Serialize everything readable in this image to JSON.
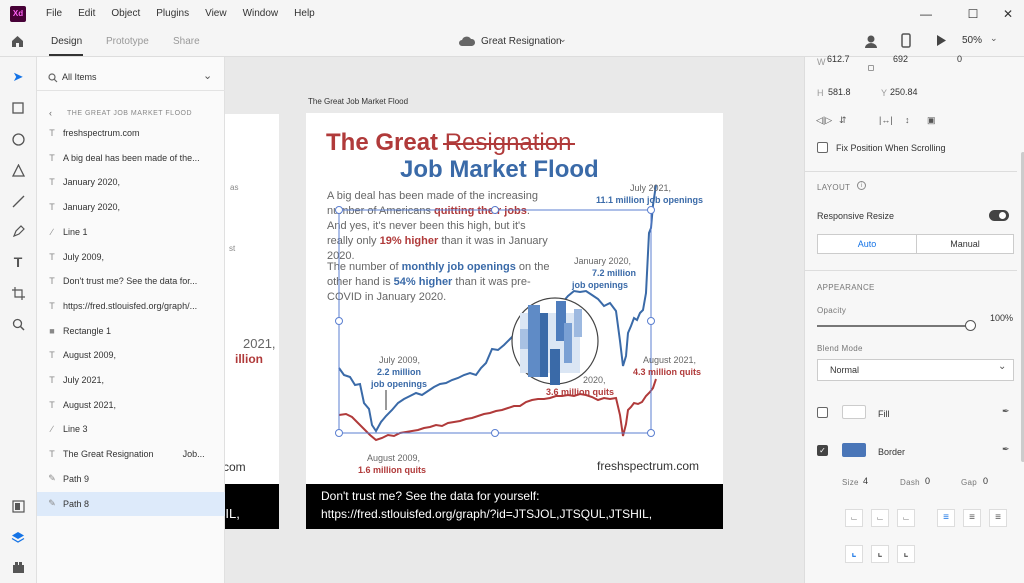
{
  "menu": [
    "File",
    "Edit",
    "Object",
    "Plugins",
    "View",
    "Window",
    "Help"
  ],
  "app_badge": "Xd",
  "toolbar": {
    "tabs": [
      "Design",
      "Prototype",
      "Share"
    ],
    "doc_title": "Great Resignation",
    "zoom": "50%"
  },
  "layers": {
    "filter": "All Items",
    "group": "THE GREAT JOB MARKET FLOOD",
    "items": [
      {
        "label": "freshspectrum.com",
        "icon": "text"
      },
      {
        "label": "A big deal has been made of the...",
        "icon": "text"
      },
      {
        "label": "January 2020,",
        "icon": "text"
      },
      {
        "label": "January 2020,",
        "icon": "text"
      },
      {
        "label": "Line 1",
        "icon": "line"
      },
      {
        "label": "July 2009,",
        "icon": "text"
      },
      {
        "label": "Don't trust me? See the data for...",
        "icon": "text"
      },
      {
        "label": "https://fred.stlouisfed.org/graph/...",
        "icon": "text"
      },
      {
        "label": "Rectangle 1",
        "icon": "rect"
      },
      {
        "label": "August 2009,",
        "icon": "text"
      },
      {
        "label": "July 2021,",
        "icon": "text"
      },
      {
        "label": "August 2021,",
        "icon": "text"
      },
      {
        "label": "Line 3",
        "icon": "line"
      },
      {
        "label": "The Great Resignation",
        "label2": "Job...",
        "icon": "text"
      },
      {
        "label": "Path 9",
        "icon": "path"
      },
      {
        "label": "Path 8",
        "icon": "path"
      }
    ]
  },
  "artboard": {
    "label": "The Great Job Market Flood",
    "title1": "The Great ",
    "title_strike": "Resignation",
    "title2": "Job Market Flood",
    "para1_a": "A big deal has been made of the increasing number of Americans ",
    "para1_b": "quitting their jobs",
    "para1_c": ". And yes, it's never been this high, but it's really only ",
    "para1_d": "19% higher",
    "para1_e": " than it was in January 2020.",
    "para2_a": "The number of ",
    "para2_b": "monthly job openings",
    "para2_c": " on the other hand is ",
    "para2_d": "54% higher",
    "para2_e": " than it was pre-COVID in January 2020.",
    "ann_jul2021_1": "July 2021,",
    "ann_jul2021_2": "11.1 million job openings",
    "ann_jan2020_1": "January 2020,",
    "ann_jan2020_2": "7.2 million",
    "ann_jan2020_3": "job openings",
    "ann_jul2009_1": "July 2009,",
    "ann_jul2009_2": "2.2 million",
    "ann_jul2009_3": "job openings",
    "ann_jan2020q_1": "2020,",
    "ann_jan2020q_2": "3.6 million quits",
    "ann_aug2021_1": "August 2021,",
    "ann_aug2021_2": "4.3 million quits",
    "ann_aug2009_1": "August 2009,",
    "ann_aug2009_2": "1.6 million quits",
    "site": "freshspectrum.com",
    "footer1": "Don't trust me? See the data for yourself:",
    "footer2": "https://fred.stlouisfed.org/graph/?id=JTSJOL,JTSQUL,JTSHIL,"
  },
  "left_artboard": {
    "frag1": "as",
    "frag2": "st",
    "frag3": "2021,",
    "frag4": "illion",
    "frag5": "n.com",
    "frag6": "HIL,"
  },
  "panel": {
    "w_label": "H",
    "w_val": "581.8",
    "y_label": "Y",
    "y_val": "250.84",
    "top_w": "612.7",
    "top_h": "692",
    "top_r": "0",
    "fix_position": "Fix Position When Scrolling",
    "layout_title": "LAYOUT",
    "responsive": "Responsive Resize",
    "auto": "Auto",
    "manual": "Manual",
    "appearance_title": "APPEARANCE",
    "opacity_label": "Opacity",
    "opacity_val": "100%",
    "blend_label": "Blend Mode",
    "blend_val": "Normal",
    "fill_label": "Fill",
    "border_label": "Border",
    "size_label": "Size",
    "size_val": "4",
    "dash_label": "Dash",
    "dash_val": "0",
    "gap_label": "Gap",
    "gap_val": "0"
  },
  "colors": {
    "red": "#b03a3a",
    "blue": "#3a6aa8",
    "accent": "#1473e6",
    "border_swatch": "#4a76b8"
  }
}
